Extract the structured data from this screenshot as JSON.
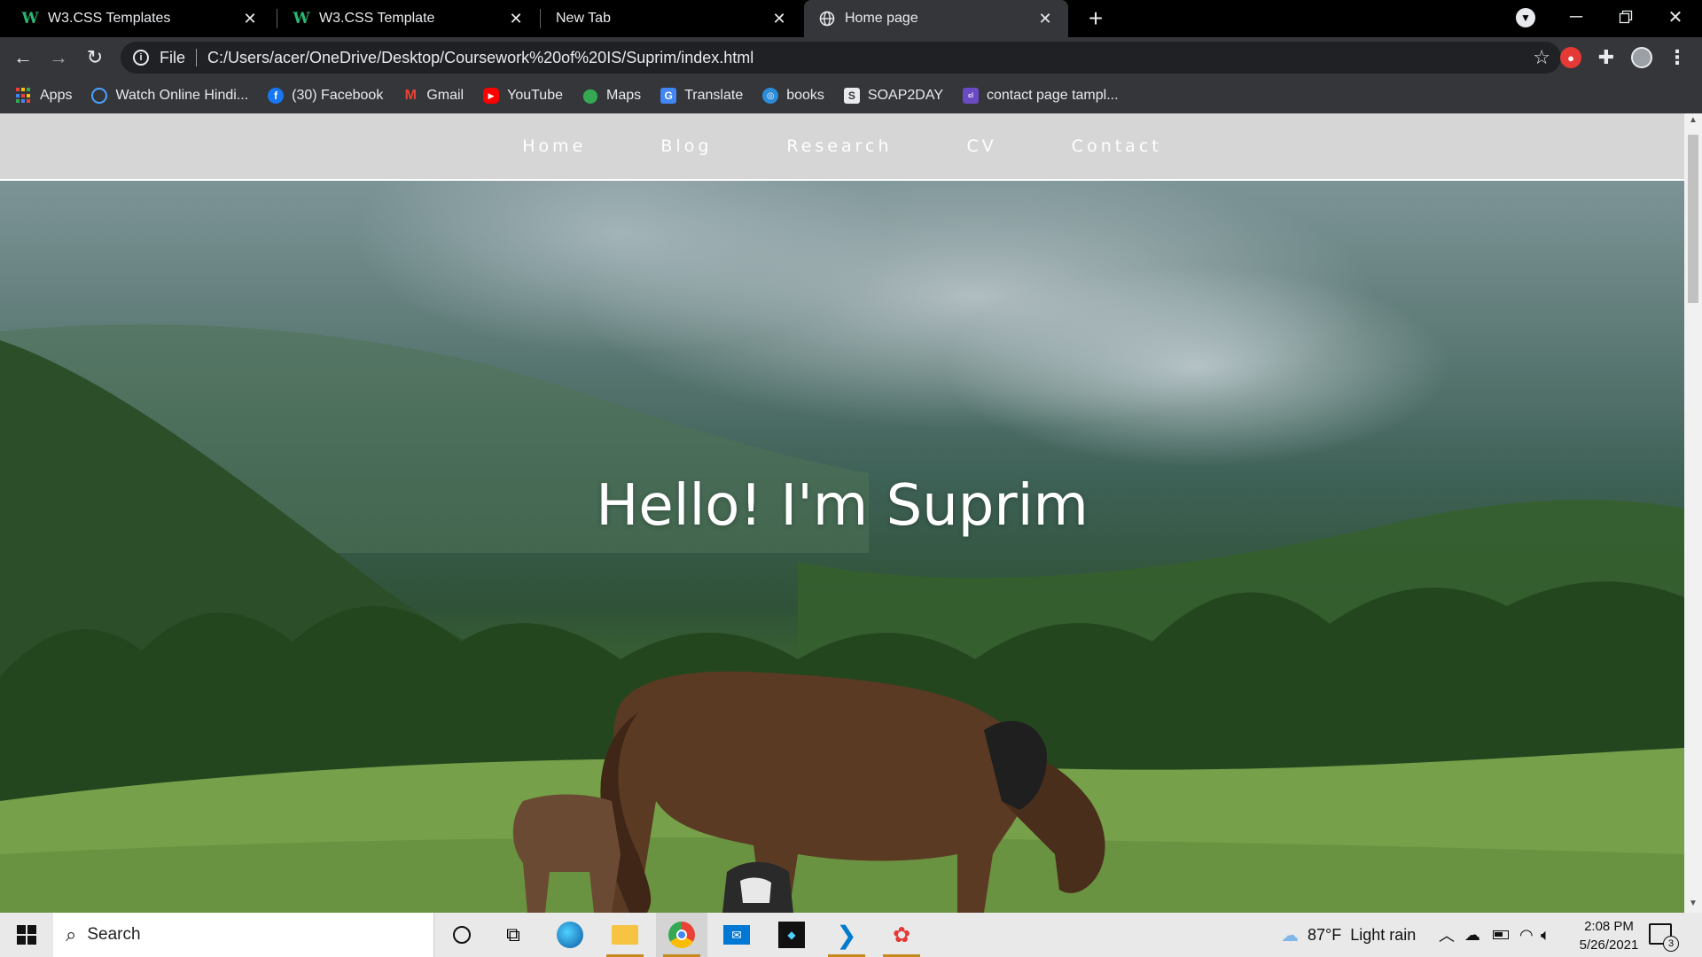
{
  "browser": {
    "tabs": [
      {
        "title": "W3.CSS Templates",
        "icon": "w3-icon",
        "favicon_text": "W"
      },
      {
        "title": "W3.CSS Template",
        "icon": "w3-icon",
        "favicon_text": "W"
      },
      {
        "title": "New Tab",
        "icon": "none"
      },
      {
        "title": "Home page",
        "icon": "globe-icon",
        "active": true
      }
    ],
    "address": {
      "scheme_label": "File",
      "url": "C:/Users/acer/OneDrive/Desktop/Coursework%20of%20IS/Suprim/index.html"
    },
    "bookmarks": [
      {
        "label": "Apps",
        "icon": "apps-grid-icon"
      },
      {
        "label": "Watch Online Hindi...",
        "icon": "watch-online-icon"
      },
      {
        "label": "(30) Facebook",
        "icon": "facebook-icon"
      },
      {
        "label": "Gmail",
        "icon": "gmail-icon"
      },
      {
        "label": "YouTube",
        "icon": "youtube-icon"
      },
      {
        "label": "Maps",
        "icon": "maps-icon"
      },
      {
        "label": "Translate",
        "icon": "translate-icon"
      },
      {
        "label": "books",
        "icon": "books-icon"
      },
      {
        "label": "SOAP2DAY",
        "icon": "soap2day-icon"
      },
      {
        "label": "contact page tampl...",
        "icon": "colorlib-icon"
      }
    ]
  },
  "page": {
    "nav": [
      "Home",
      "Blog",
      "Research",
      "CV",
      "Contact"
    ],
    "hero_title": "Hello! I'm Suprim"
  },
  "taskbar": {
    "search_placeholder": "Search",
    "weather": "87°F  Light rain",
    "time": "2:08 PM",
    "date": "5/26/2021",
    "notification_count": "3"
  },
  "colors": {
    "tab_strip": "#000000",
    "toolbar": "#35363a",
    "navbar": "#d6d6d6",
    "taskbar": "#e9e9e9"
  }
}
